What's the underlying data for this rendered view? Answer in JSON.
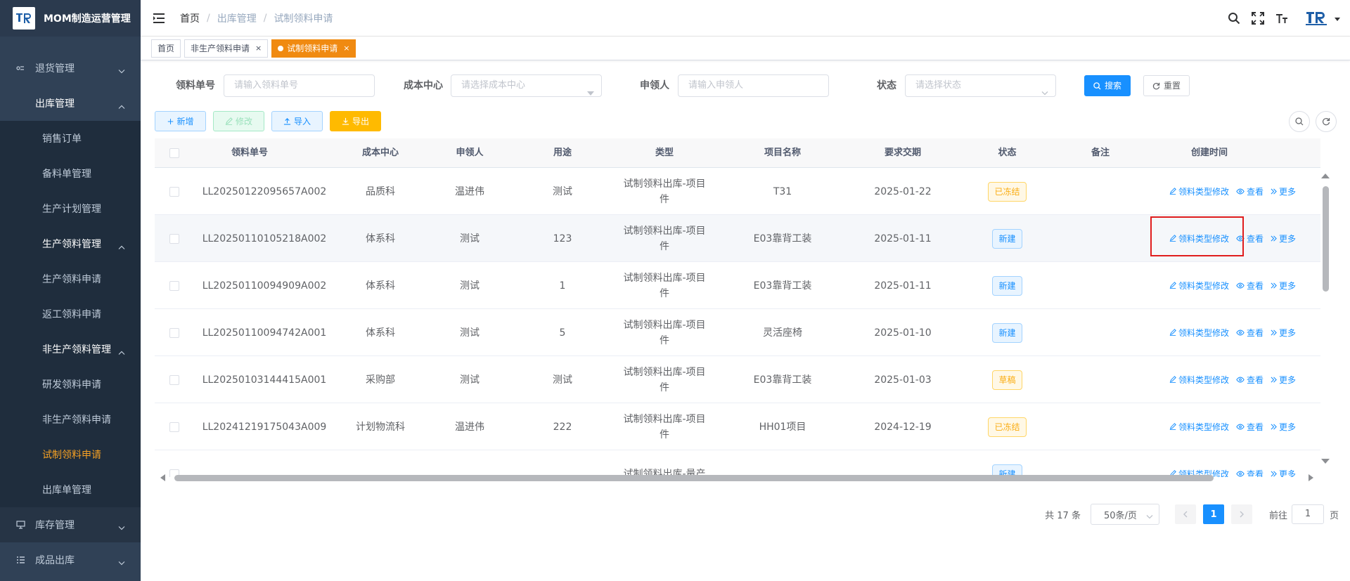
{
  "app": {
    "title": "MOM制造运营管理"
  },
  "sidebar": {
    "items": [
      {
        "label": "退货管理",
        "type": "top",
        "icon": "return-icon",
        "chevron": "down"
      },
      {
        "label": "出库管理",
        "type": "open",
        "chevron": "up"
      },
      {
        "label": "销售订单",
        "type": "sub"
      },
      {
        "label": "备料单管理",
        "type": "sub"
      },
      {
        "label": "生产计划管理",
        "type": "sub"
      },
      {
        "label": "生产领料管理",
        "type": "group",
        "chevron": "up"
      },
      {
        "label": "生产领料申请",
        "type": "sub"
      },
      {
        "label": "返工领料申请",
        "type": "sub"
      },
      {
        "label": "非生产领料管理",
        "type": "group",
        "chevron": "up"
      },
      {
        "label": "研发领料申请",
        "type": "sub"
      },
      {
        "label": "非生产领料申请",
        "type": "sub"
      },
      {
        "label": "试制领料申请",
        "type": "sub",
        "active": true
      },
      {
        "label": "出库单管理",
        "type": "sub"
      },
      {
        "label": "库存管理",
        "type": "top",
        "icon": "monitor-icon",
        "chevron": "down"
      },
      {
        "label": "成品出库",
        "type": "top",
        "icon": "list-icon",
        "chevron": "down"
      }
    ]
  },
  "breadcrumb": [
    "首页",
    "出库管理",
    "试制领料申请"
  ],
  "tags": [
    {
      "label": "首页",
      "active": false,
      "closable": false
    },
    {
      "label": "非生产领料申请",
      "active": false,
      "closable": true
    },
    {
      "label": "试制领料申请",
      "active": true,
      "closable": true
    }
  ],
  "tag_close_glyph": "×",
  "search": {
    "order_no": {
      "label": "领料单号",
      "placeholder": "请输入领料单号"
    },
    "cost_center": {
      "label": "成本中心",
      "placeholder": "请选择成本中心"
    },
    "applicant": {
      "label": "申领人",
      "placeholder": "请输入申领人"
    },
    "status": {
      "label": "状态",
      "placeholder": "请选择状态"
    },
    "search_button": "搜索",
    "reset_button": "重置"
  },
  "toolbar": {
    "add": "新增",
    "edit": "修改",
    "import": "导入",
    "export": "导出"
  },
  "table": {
    "columns": [
      "领料单号",
      "成本中心",
      "申领人",
      "用途",
      "类型",
      "项目名称",
      "要求交期",
      "状态",
      "备注",
      "创建时间"
    ],
    "actions": {
      "modify_type": "领料类型修改",
      "view": "查看",
      "more": "更多"
    },
    "rows": [
      {
        "order_no": "LL20250122095657A002",
        "cost_center": "品质科",
        "applicant": "温进伟",
        "purpose": "测试",
        "type": "试制领料出库-项目件",
        "project": "T31",
        "due": "2025-01-22",
        "status": "已冻结",
        "status_color": "orange"
      },
      {
        "order_no": "LL20250110105218A002",
        "cost_center": "体系科",
        "applicant": "测试",
        "purpose": "123",
        "type": "试制领料出库-项目件",
        "project": "E03靠背工装",
        "due": "2025-01-11",
        "status": "新建",
        "status_color": "blue"
      },
      {
        "order_no": "LL20250110094909A002",
        "cost_center": "体系科",
        "applicant": "测试",
        "purpose": "1",
        "type": "试制领料出库-项目件",
        "project": "E03靠背工装",
        "due": "2025-01-11",
        "status": "新建",
        "status_color": "blue"
      },
      {
        "order_no": "LL20250110094742A001",
        "cost_center": "体系科",
        "applicant": "测试",
        "purpose": "5",
        "type": "试制领料出库-项目件",
        "project": "灵活座椅",
        "due": "2025-01-10",
        "status": "新建",
        "status_color": "blue"
      },
      {
        "order_no": "LL20250103144415A001",
        "cost_center": "采购部",
        "applicant": "测试",
        "purpose": "测试",
        "type": "试制领料出库-项目件",
        "project": "E03靠背工装",
        "due": "2025-01-03",
        "status": "草稿",
        "status_color": "orange"
      },
      {
        "order_no": "LL20241219175043A009",
        "cost_center": "计划物流科",
        "applicant": "温进伟",
        "purpose": "222",
        "type": "试制领料出库-项目件",
        "project": "HH01项目",
        "due": "2024-12-19",
        "status": "已冻结",
        "status_color": "orange"
      },
      {
        "order_no": "",
        "cost_center": "",
        "applicant": "",
        "purpose": "",
        "type": "试制领料出库-量产",
        "project": "",
        "due": "",
        "status": "新建",
        "status_color": "blue"
      }
    ]
  },
  "pagination": {
    "total": "共 17 条",
    "page_size": "50条/页",
    "current": "1",
    "goto_label": "前往",
    "goto_value": "1",
    "page_unit": "页"
  },
  "colors": {
    "sidebar_bg": "#304156",
    "active_menu": "#f4a024",
    "primary": "#1890ff",
    "active_tag": "#f08a11",
    "export_btn": "#ffba00",
    "highlight_box": "#e01d1d"
  }
}
